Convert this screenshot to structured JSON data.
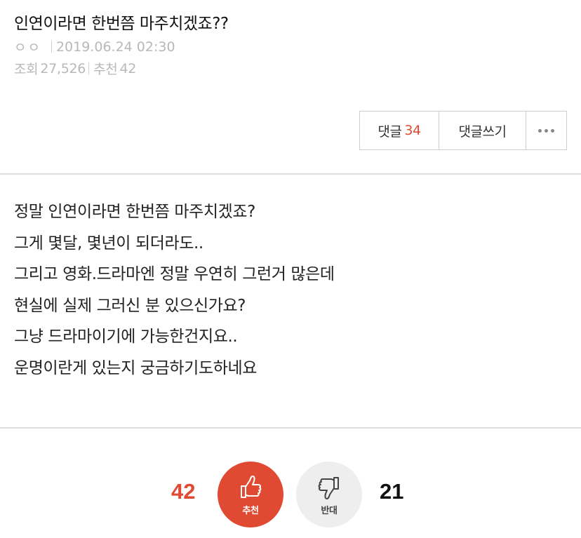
{
  "post": {
    "title": "인연이라면 한번쯤 마주치겠죠??",
    "author": "ㅇㅇ",
    "date": "2019.06.24 02:30",
    "views_label": "조회",
    "views": "27,526",
    "recommend_label": "추천",
    "recommend_count": "42"
  },
  "actions": {
    "comments_label": "댓글",
    "comments_count": "34",
    "write_label": "댓글쓰기",
    "more_icon": "more-dots-icon"
  },
  "content": {
    "lines": [
      "정말 인연이라면 한번쯤 마주치겠죠?",
      "그게 몇달, 몇년이 되더라도..",
      "그리고 영화.드라마엔 정말 우연히 그런거 많은데",
      "현실에 실제 그러신 분 있으신가요?",
      "그냥 드라마이기에 가능한건지요..",
      "운명이란게 있는지 궁금하기도하네요"
    ]
  },
  "vote": {
    "up_count": "42",
    "up_label": "추천",
    "up_icon": "thumbs-up-icon",
    "down_count": "21",
    "down_label": "반대",
    "down_icon": "thumbs-down-icon"
  },
  "colors": {
    "accent": "#e04a32",
    "meta_gray": "#b8b8b8",
    "down_bg": "#eeeeee"
  }
}
